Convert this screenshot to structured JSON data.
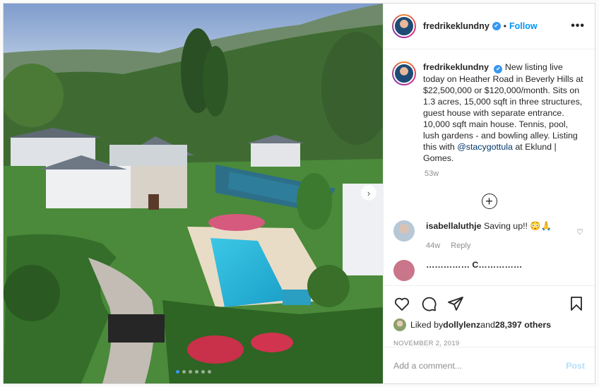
{
  "post": {
    "image_alt": "Aerial view of Beverly Hills estate with pool and tennis court",
    "slides_total": 6,
    "active_slide": 1
  },
  "header": {
    "username": "fredrikeklundny",
    "verified_mark": "✔",
    "separator": "•",
    "follow_label": "Follow",
    "more_label": "•••"
  },
  "caption": {
    "username": "fredrikeklundny",
    "text_before": "New listing live today on Heather Road in Beverly Hills at $22,500,000 or $120,000/month. Sits on 1.3 acres, 15,000 sqft in three structures, guest house with separate entrance. 10,000 sqft main house. Tennis, pool, lush gardens - and bowling alley. Listing this with ",
    "mention": "@stacygottula",
    "text_after": " at Eklund | Gomes.",
    "time": "53w"
  },
  "load_more": {
    "icon": "+"
  },
  "comments": [
    {
      "username": "isabellaluthje",
      "text": "Saving up!! 😳🙏",
      "time": "44w",
      "reply_label": "Reply",
      "like_icon": "♡"
    }
  ],
  "partial_comment": {
    "text": "…………… C……………"
  },
  "actions": {
    "liked_by_prefix": "Liked by ",
    "liked_by_user": "dollylenz",
    "liked_by_and": " and ",
    "liked_by_count": "28,397 others",
    "date": "NOVEMBER 2, 2019"
  },
  "comment_box": {
    "placeholder": "Add a comment...",
    "post_label": "Post"
  },
  "colors": {
    "accent": "#0095f6",
    "post_disabled": "#b2dffc",
    "pool": "#2bb5d8",
    "muted": "#8e8e8e"
  },
  "icons": [
    "heart-icon",
    "comment-icon",
    "share-icon",
    "bookmark-icon",
    "verified-icon",
    "more-icon",
    "next-arrow-icon"
  ]
}
